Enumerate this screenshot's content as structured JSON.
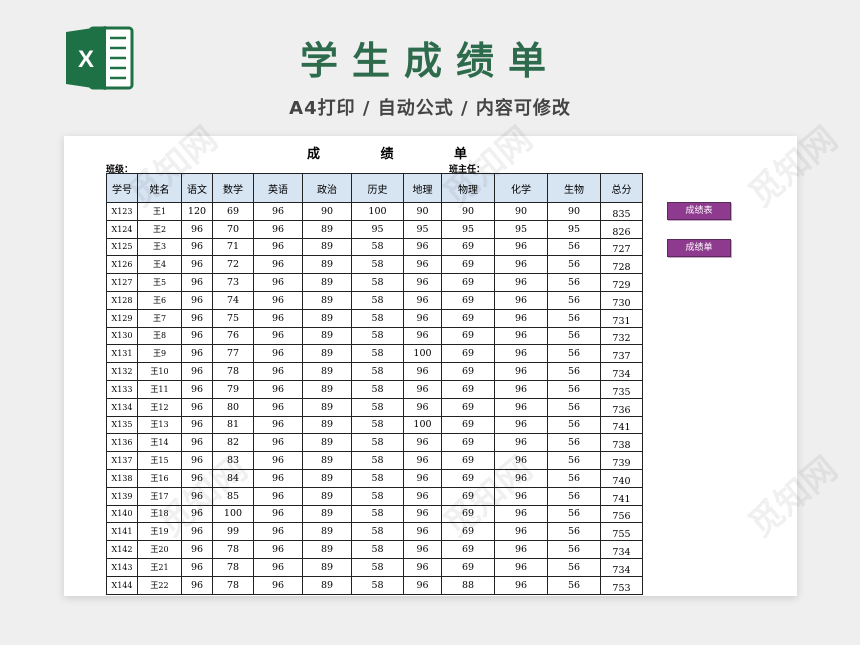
{
  "header": {
    "title": "学生成绩单",
    "subtitle": "A4打印 / 自动公式 / 内容可修改"
  },
  "logo": {
    "letter": "X",
    "icon": "excel-icon",
    "color": "#1e7145"
  },
  "sheet": {
    "title": "成 绩 单",
    "class_label": "班级：",
    "teacher_label": "班主任：",
    "columns": [
      "学号",
      "姓名",
      "语文",
      "数学",
      "英语",
      "政治",
      "历史",
      "地理",
      "物理",
      "化学",
      "生物",
      "总分"
    ],
    "rows": [
      [
        "X123",
        "王1",
        "120",
        "69",
        "96",
        "90",
        "100",
        "90",
        "90",
        "90",
        "90",
        "835"
      ],
      [
        "X124",
        "王2",
        "96",
        "70",
        "96",
        "89",
        "95",
        "95",
        "95",
        "95",
        "95",
        "826"
      ],
      [
        "X125",
        "王3",
        "96",
        "71",
        "96",
        "89",
        "58",
        "96",
        "69",
        "96",
        "56",
        "727"
      ],
      [
        "X126",
        "王4",
        "96",
        "72",
        "96",
        "89",
        "58",
        "96",
        "69",
        "96",
        "56",
        "728"
      ],
      [
        "X127",
        "王5",
        "96",
        "73",
        "96",
        "89",
        "58",
        "96",
        "69",
        "96",
        "56",
        "729"
      ],
      [
        "X128",
        "王6",
        "96",
        "74",
        "96",
        "89",
        "58",
        "96",
        "69",
        "96",
        "56",
        "730"
      ],
      [
        "X129",
        "王7",
        "96",
        "75",
        "96",
        "89",
        "58",
        "96",
        "69",
        "96",
        "56",
        "731"
      ],
      [
        "X130",
        "王8",
        "96",
        "76",
        "96",
        "89",
        "58",
        "96",
        "69",
        "96",
        "56",
        "732"
      ],
      [
        "X131",
        "王9",
        "96",
        "77",
        "96",
        "89",
        "58",
        "100",
        "69",
        "96",
        "56",
        "737"
      ],
      [
        "X132",
        "王10",
        "96",
        "78",
        "96",
        "89",
        "58",
        "96",
        "69",
        "96",
        "56",
        "734"
      ],
      [
        "X133",
        "王11",
        "96",
        "79",
        "96",
        "89",
        "58",
        "96",
        "69",
        "96",
        "56",
        "735"
      ],
      [
        "X134",
        "王12",
        "96",
        "80",
        "96",
        "89",
        "58",
        "96",
        "69",
        "96",
        "56",
        "736"
      ],
      [
        "X135",
        "王13",
        "96",
        "81",
        "96",
        "89",
        "58",
        "100",
        "69",
        "96",
        "56",
        "741"
      ],
      [
        "X136",
        "王14",
        "96",
        "82",
        "96",
        "89",
        "58",
        "96",
        "69",
        "96",
        "56",
        "738"
      ],
      [
        "X137",
        "王15",
        "96",
        "83",
        "96",
        "89",
        "58",
        "96",
        "69",
        "96",
        "56",
        "739"
      ],
      [
        "X138",
        "王16",
        "96",
        "84",
        "96",
        "89",
        "58",
        "96",
        "69",
        "96",
        "56",
        "740"
      ],
      [
        "X139",
        "王17",
        "96",
        "85",
        "96",
        "89",
        "58",
        "96",
        "69",
        "96",
        "56",
        "741"
      ],
      [
        "X140",
        "王18",
        "96",
        "100",
        "96",
        "89",
        "58",
        "96",
        "69",
        "96",
        "56",
        "756"
      ],
      [
        "X141",
        "王19",
        "96",
        "99",
        "96",
        "89",
        "58",
        "96",
        "69",
        "96",
        "56",
        "755"
      ],
      [
        "X142",
        "王20",
        "96",
        "78",
        "96",
        "89",
        "58",
        "96",
        "69",
        "96",
        "56",
        "734"
      ],
      [
        "X143",
        "王21",
        "96",
        "78",
        "96",
        "89",
        "58",
        "96",
        "69",
        "96",
        "56",
        "734"
      ],
      [
        "X144",
        "王22",
        "96",
        "78",
        "96",
        "89",
        "58",
        "96",
        "88",
        "96",
        "56",
        "753"
      ]
    ]
  },
  "side_buttons": {
    "scores_table": "成绩表",
    "scores_list": "成绩单"
  },
  "colors": {
    "title_green": "#2e6b4c",
    "header_fill": "#d7e4f2",
    "button_purple": "#8e3b8f"
  },
  "watermark": "觅知网"
}
